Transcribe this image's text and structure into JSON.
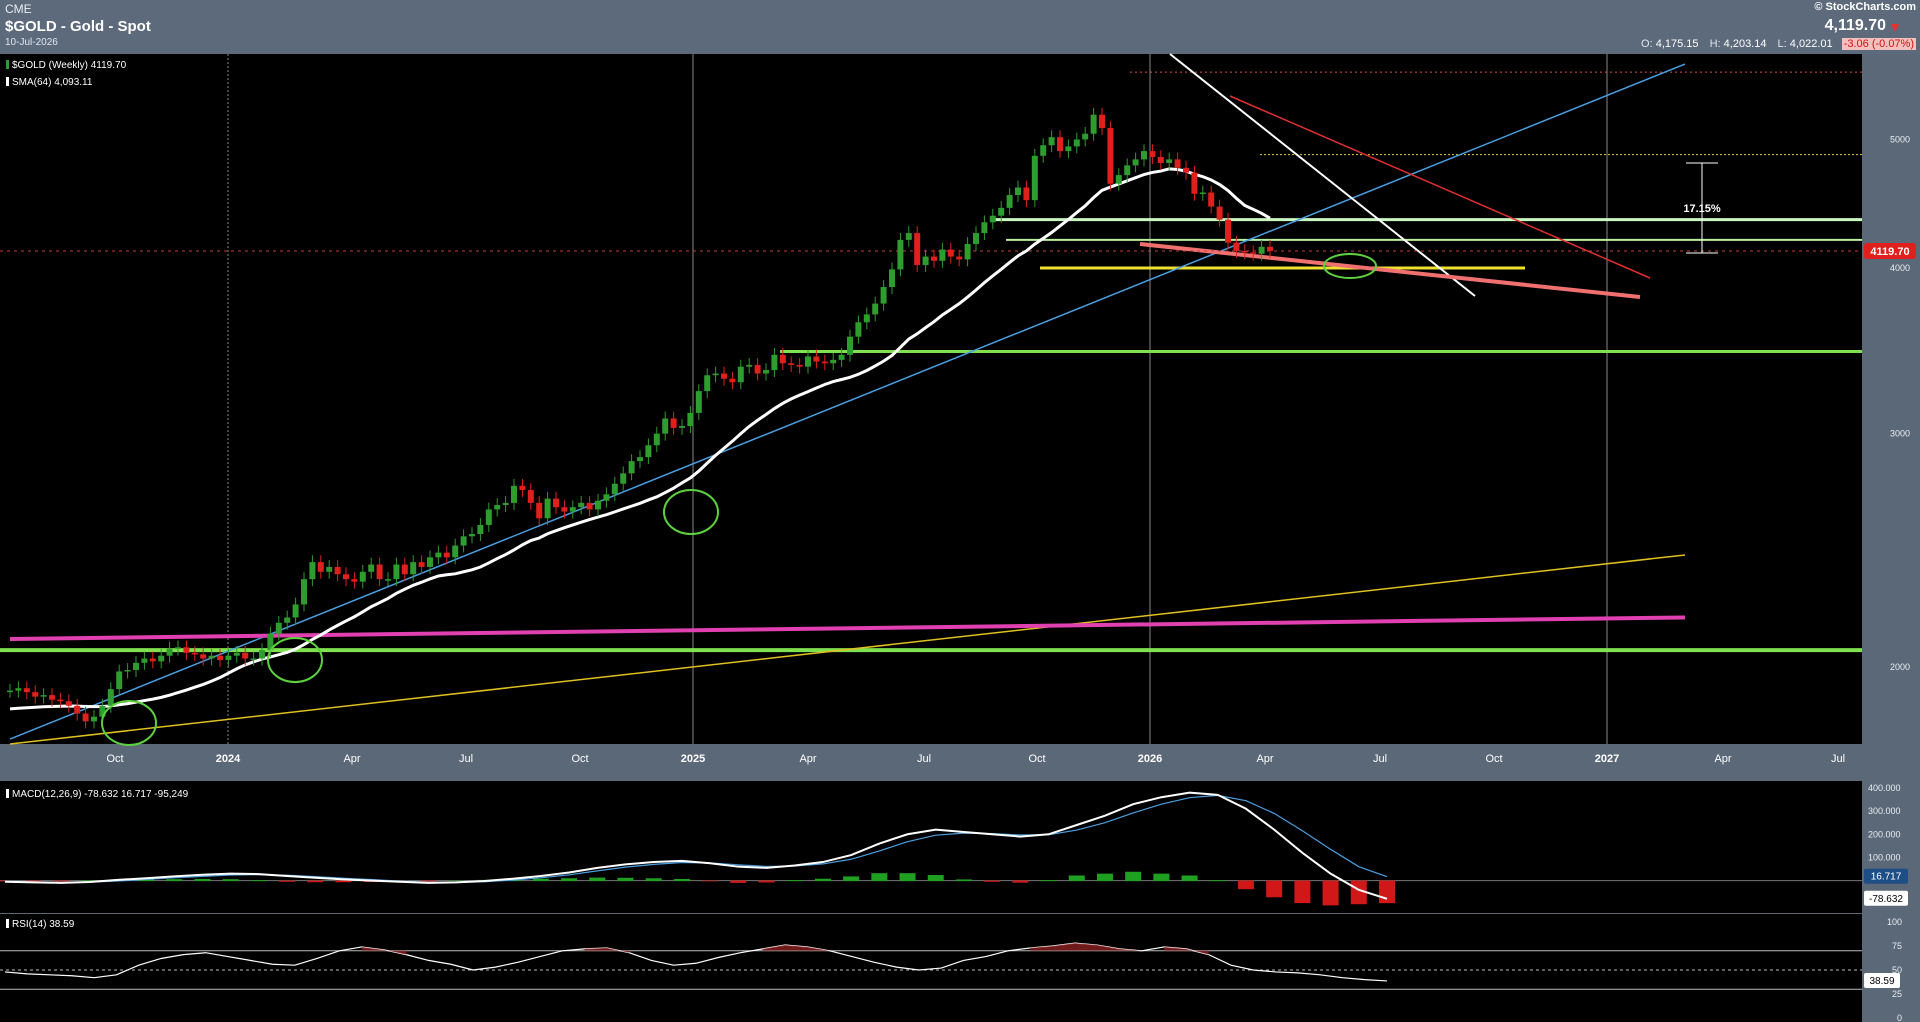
{
  "header": {
    "exchange": "CME",
    "title": "$GOLD - Gold - Spot",
    "date": "10-Jul-2026",
    "brand": "© StockCharts.com",
    "last": "4,119.70",
    "open_label": "O:",
    "open": "4,175.15",
    "high_label": "H:",
    "high": "4,203.14",
    "low_label": "L:",
    "low": "4,022.01",
    "change": "-3.06 (-0.07%)"
  },
  "legends": {
    "price": "$GOLD (Weekly) 4119.70",
    "sma": "SMA(64) 4,093.11",
    "macd": "MACD(12,26,9) -78.632   16.717  -95,249",
    "rsi": "RSI(14) 38.59"
  },
  "colors": {
    "up": "#2e9c2e",
    "down": "#e0201c",
    "sma": "#ffffff",
    "blue_trend": "#4a9fe0",
    "yellow_trend": "#e0c020",
    "magenta": "#e040b0",
    "green_support": "#7fe050",
    "price_tag": "#e0201c"
  },
  "chart_data": [
    {
      "type": "candlestick",
      "title": "$GOLD - Gold - Spot",
      "timeframe": "Weekly",
      "x_ticks": [
        "Oct",
        "2024",
        "Apr",
        "Jul",
        "Oct",
        "2025",
        "Apr",
        "Jul",
        "Oct",
        "2026",
        "Apr",
        "Jul",
        "Oct",
        "2027",
        "Apr",
        "Jul"
      ],
      "y_ticks": [
        2000,
        3000,
        4000,
        5000
      ],
      "y_scale": "log",
      "last_price_tag": "4119.70",
      "annotation": "17.15%",
      "x_range": [
        "2023-07-01",
        "2027-08-01"
      ],
      "y_range": [
        1750,
        5800
      ],
      "closes": [
        1920,
        1928,
        1915,
        1900,
        1905,
        1890,
        1885,
        1870,
        1845,
        1820,
        1835,
        1870,
        1925,
        1985,
        1990,
        2015,
        2030,
        2020,
        2040,
        2065,
        2070,
        2050,
        2045,
        2030,
        2040,
        2025,
        2040,
        2050,
        2030,
        2030,
        2060,
        2120,
        2160,
        2180,
        2230,
        2330,
        2400,
        2360,
        2380,
        2350,
        2330,
        2320,
        2360,
        2390,
        2330,
        2330,
        2390,
        2350,
        2400,
        2380,
        2420,
        2440,
        2420,
        2470,
        2510,
        2520,
        2560,
        2630,
        2650,
        2660,
        2740,
        2720,
        2660,
        2590,
        2680,
        2640,
        2620,
        2640,
        2660,
        2630,
        2670,
        2700,
        2750,
        2800,
        2860,
        2880,
        2940,
        3000,
        3080,
        3030,
        3040,
        3110,
        3230,
        3320,
        3330,
        3300,
        3280,
        3370,
        3380,
        3330,
        3350,
        3440,
        3390,
        3380,
        3370,
        3430,
        3400,
        3390,
        3410,
        3440,
        3550,
        3640,
        3690,
        3760,
        3870,
        3990,
        4200,
        4250,
        4020,
        4080,
        4050,
        4130,
        4080,
        4060,
        4170,
        4250,
        4330,
        4380,
        4440,
        4540,
        4600,
        4500,
        4860,
        4950,
        5020,
        4900,
        4940,
        5000,
        5050,
        5220,
        5100,
        4630,
        4700,
        4780,
        4830,
        4900,
        4850,
        4800,
        4830,
        4760,
        4720,
        4550,
        4560,
        4450,
        4350,
        4180,
        4120,
        4110,
        4100,
        4150,
        4120
      ],
      "sma64": {
        "start_value": 1860,
        "end_value": 4093.11
      },
      "trendlines": [
        {
          "name": "blue",
          "from": [
            0,
            1765
          ],
          "to": [
            200,
            5700
          ]
        },
        {
          "name": "yellow",
          "from": [
            0,
            1750
          ],
          "to": [
            200,
            2430
          ]
        },
        {
          "name": "magenta",
          "from": [
            0,
            2100
          ],
          "to": [
            200,
            2180
          ]
        }
      ],
      "horizontal_levels": [
        2060,
        3460,
        4000,
        4200,
        4350,
        4870,
        5620
      ]
    },
    {
      "type": "line",
      "title": "MACD(12,26,9)",
      "y_ticks": [
        400,
        300,
        200,
        100
      ],
      "series": [
        {
          "values": [
            -5,
            -8,
            -10,
            -6,
            3,
            10,
            18,
            25,
            30,
            28,
            20,
            12,
            5,
            0,
            -5,
            -10,
            -8,
            -2,
            8,
            20,
            35,
            55,
            70,
            80,
            85,
            75,
            60,
            55,
            65,
            80,
            110,
            160,
            200,
            220,
            210,
            200,
            190,
            200,
            240,
            280,
            330,
            360,
            380,
            370,
            310,
            220,
            120,
            30,
            -40,
            -78.632
          ]
        },
        {
          "values": [
            -3,
            -6,
            -8,
            -7,
            -2,
            5,
            12,
            18,
            24,
            26,
            23,
            17,
            10,
            4,
            -2,
            -7,
            -8,
            -5,
            2,
            12,
            25,
            42,
            58,
            70,
            78,
            76,
            68,
            61,
            63,
            72,
            92,
            128,
            168,
            196,
            205,
            203,
            197,
            198,
            218,
            250,
            292,
            330,
            358,
            368,
            345,
            290,
            215,
            135,
            60,
            16.717
          ]
        }
      ],
      "value_tags": [
        "16.717",
        "-78.632"
      ]
    },
    {
      "type": "line",
      "title": "RSI(14)",
      "y_ticks": [
        100,
        75,
        50,
        25,
        0
      ],
      "series": [
        {
          "values": [
            48,
            46,
            45,
            44,
            42,
            45,
            55,
            62,
            66,
            68,
            64,
            60,
            56,
            55,
            62,
            70,
            74,
            71,
            66,
            60,
            56,
            50,
            53,
            58,
            64,
            70,
            72,
            73,
            68,
            60,
            55,
            57,
            63,
            68,
            72,
            76,
            74,
            70,
            64,
            58,
            53,
            50,
            52,
            60,
            64,
            70,
            73,
            75,
            78,
            76,
            72,
            70,
            74,
            72,
            66,
            55,
            50,
            48,
            47,
            45,
            42,
            40,
            38.59
          ]
        }
      ],
      "value_tags": [
        "38.59"
      ]
    }
  ]
}
